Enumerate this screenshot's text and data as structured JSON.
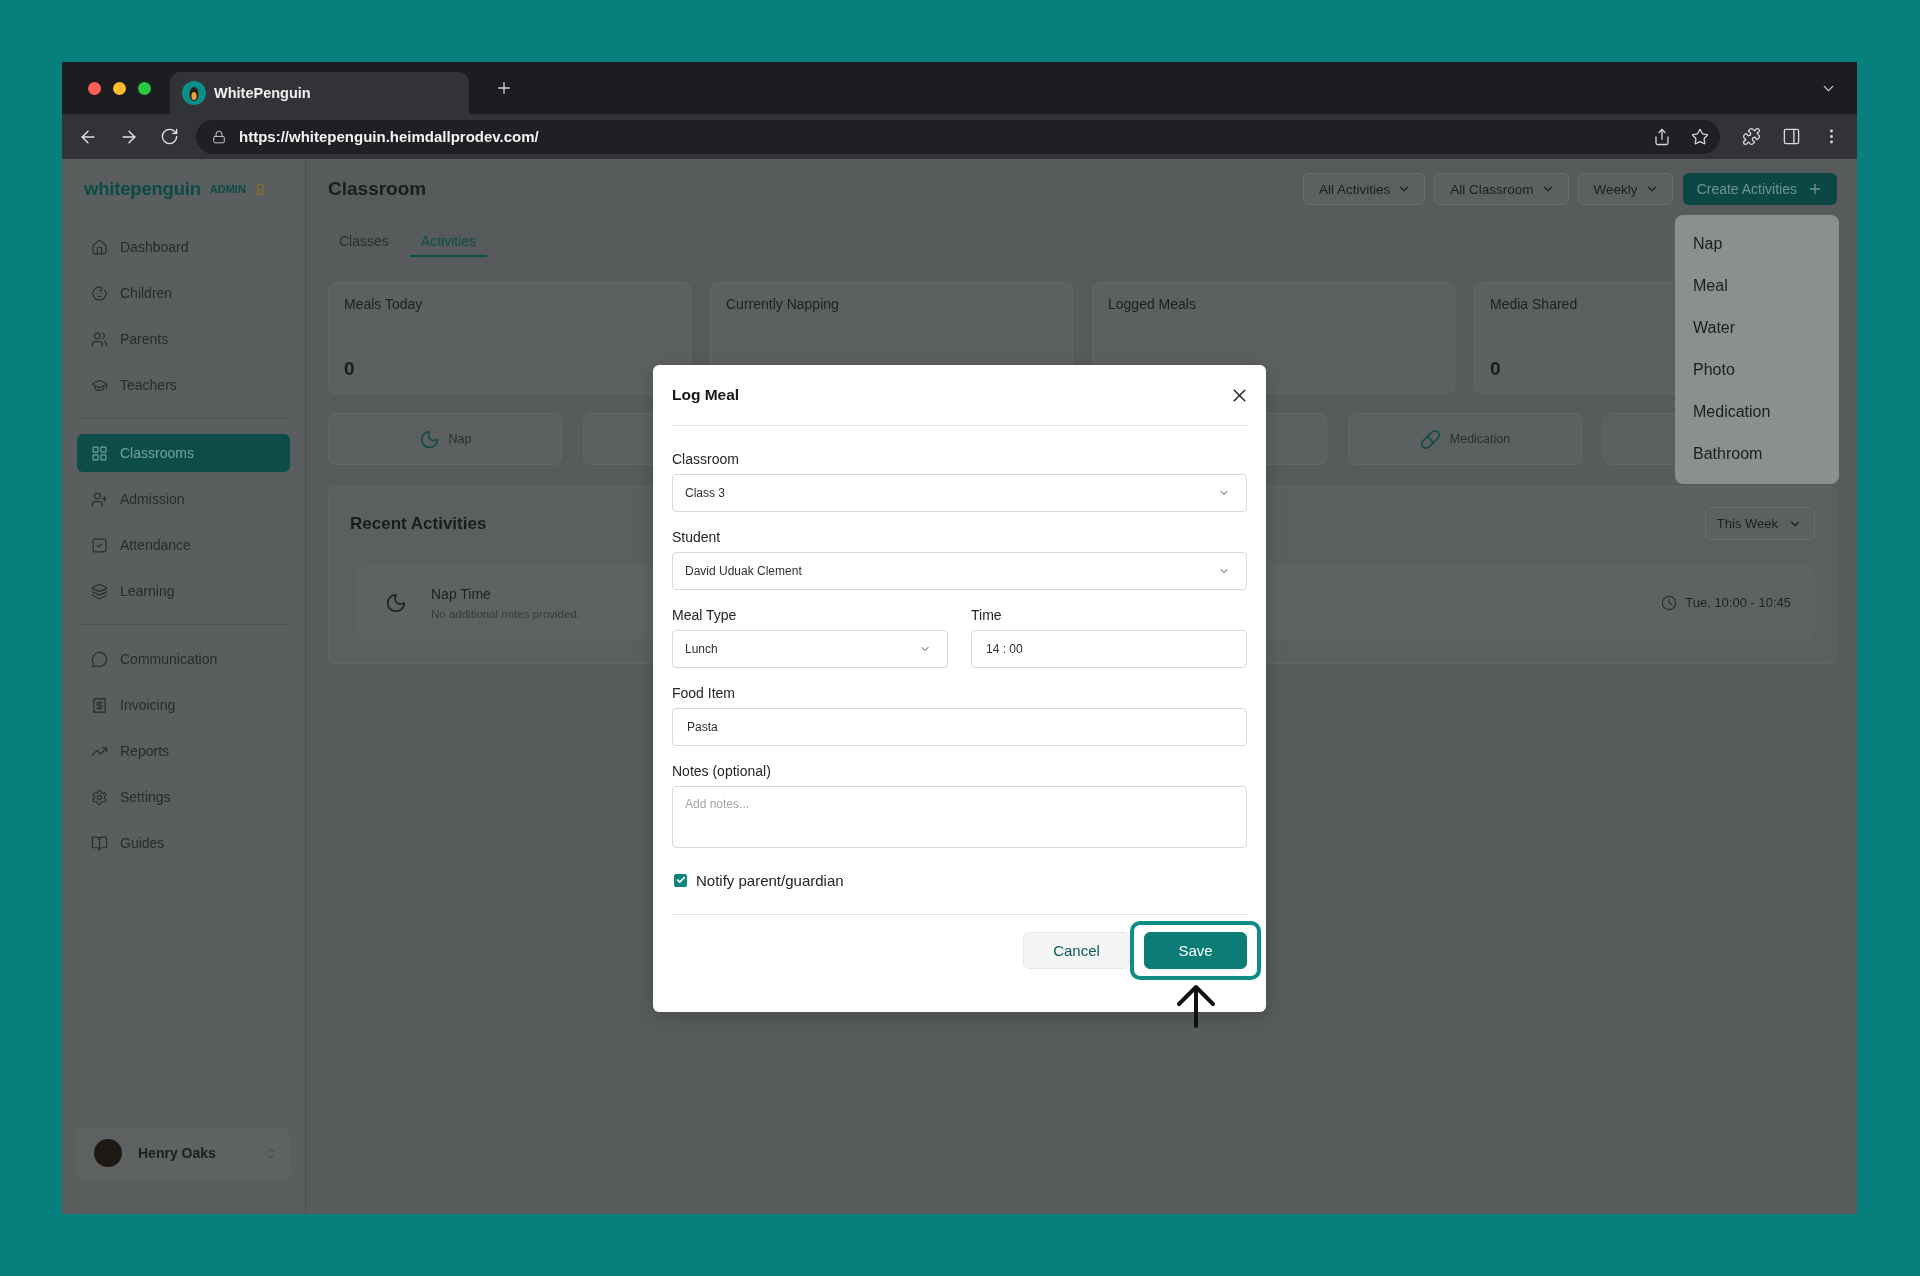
{
  "browser": {
    "tab_title": "WhitePenguin",
    "url": "https://whitepenguin.heimdallprodev.com/"
  },
  "sidebar": {
    "logo": "whitepenguin",
    "role": "ADMIN",
    "sections": [
      {
        "items": [
          {
            "label": "Dashboard",
            "selected": false
          },
          {
            "label": "Children",
            "selected": false
          },
          {
            "label": "Parents",
            "selected": false
          },
          {
            "label": "Teachers",
            "selected": false
          }
        ]
      },
      {
        "items": [
          {
            "label": "Classrooms",
            "selected": true
          },
          {
            "label": "Admission",
            "selected": false
          },
          {
            "label": "Attendance",
            "selected": false
          },
          {
            "label": "Learning",
            "selected": false
          }
        ]
      },
      {
        "items": [
          {
            "label": "Communication",
            "selected": false
          },
          {
            "label": "Invoicing",
            "selected": false
          },
          {
            "label": "Reports",
            "selected": false
          },
          {
            "label": "Settings",
            "selected": false
          },
          {
            "label": "Guides",
            "selected": false
          }
        ]
      }
    ],
    "user": {
      "name": "Henry Oaks"
    }
  },
  "header": {
    "title": "Classroom",
    "filters": [
      {
        "label": "All Activities"
      },
      {
        "label": "All Classroom"
      },
      {
        "label": "Weekly"
      }
    ],
    "create_button": {
      "label": "Create Activities"
    }
  },
  "tabs": [
    {
      "label": "Classes",
      "selected": false
    },
    {
      "label": "Activities",
      "selected": true
    }
  ],
  "stats": [
    {
      "label": "Meals Today",
      "value": "0"
    },
    {
      "label": "Currently Napping"
    },
    {
      "label": "Logged Meals"
    },
    {
      "label": "Media Shared",
      "value": "0"
    }
  ],
  "quick_actions": [
    {
      "kind": "nap",
      "label": "Nap"
    },
    {
      "kind": "blank"
    },
    {
      "kind": "hidden"
    },
    {
      "kind": "blank"
    },
    {
      "kind": "medication",
      "label": "Medication"
    },
    {
      "kind": "blank"
    }
  ],
  "create_menu": {
    "items": [
      {
        "label": "Nap"
      },
      {
        "label": "Meal"
      },
      {
        "label": "Water"
      },
      {
        "label": "Photo"
      },
      {
        "label": "Medication"
      },
      {
        "label": "Bathroom"
      }
    ]
  },
  "recent_activities": {
    "title": "Recent Activities",
    "period": "This Week",
    "items": [
      {
        "title": "Nap Time",
        "note": "No additional notes provided.",
        "time": "Tue, 10:00 - 10:45"
      }
    ]
  },
  "modal": {
    "title": "Log Meal",
    "rows": [
      {
        "fields": [
          {
            "kind": "select",
            "label": "Classroom",
            "value": "Class 3"
          }
        ]
      },
      {
        "fields": [
          {
            "kind": "select",
            "label": "Student",
            "value": "David Uduak Clement"
          }
        ]
      },
      {
        "fields": [
          {
            "kind": "select",
            "label": "Meal Type",
            "value": "Lunch"
          },
          {
            "kind": "text",
            "label": "Time",
            "value": "14 : 00"
          }
        ]
      },
      {
        "fields": [
          {
            "kind": "text",
            "label": "Food Item",
            "value": "Pasta"
          }
        ]
      },
      {
        "fields": [
          {
            "kind": "textarea",
            "label": "Notes (optional)",
            "placeholder": "Add notes..."
          }
        ]
      }
    ],
    "notify": {
      "label": "Notify parent/guardian",
      "checked": true
    },
    "buttons": [
      {
        "kind": "secondary",
        "label": "Cancel",
        "highlighted": false
      },
      {
        "kind": "primary",
        "label": "Save",
        "highlighted": true
      }
    ]
  }
}
